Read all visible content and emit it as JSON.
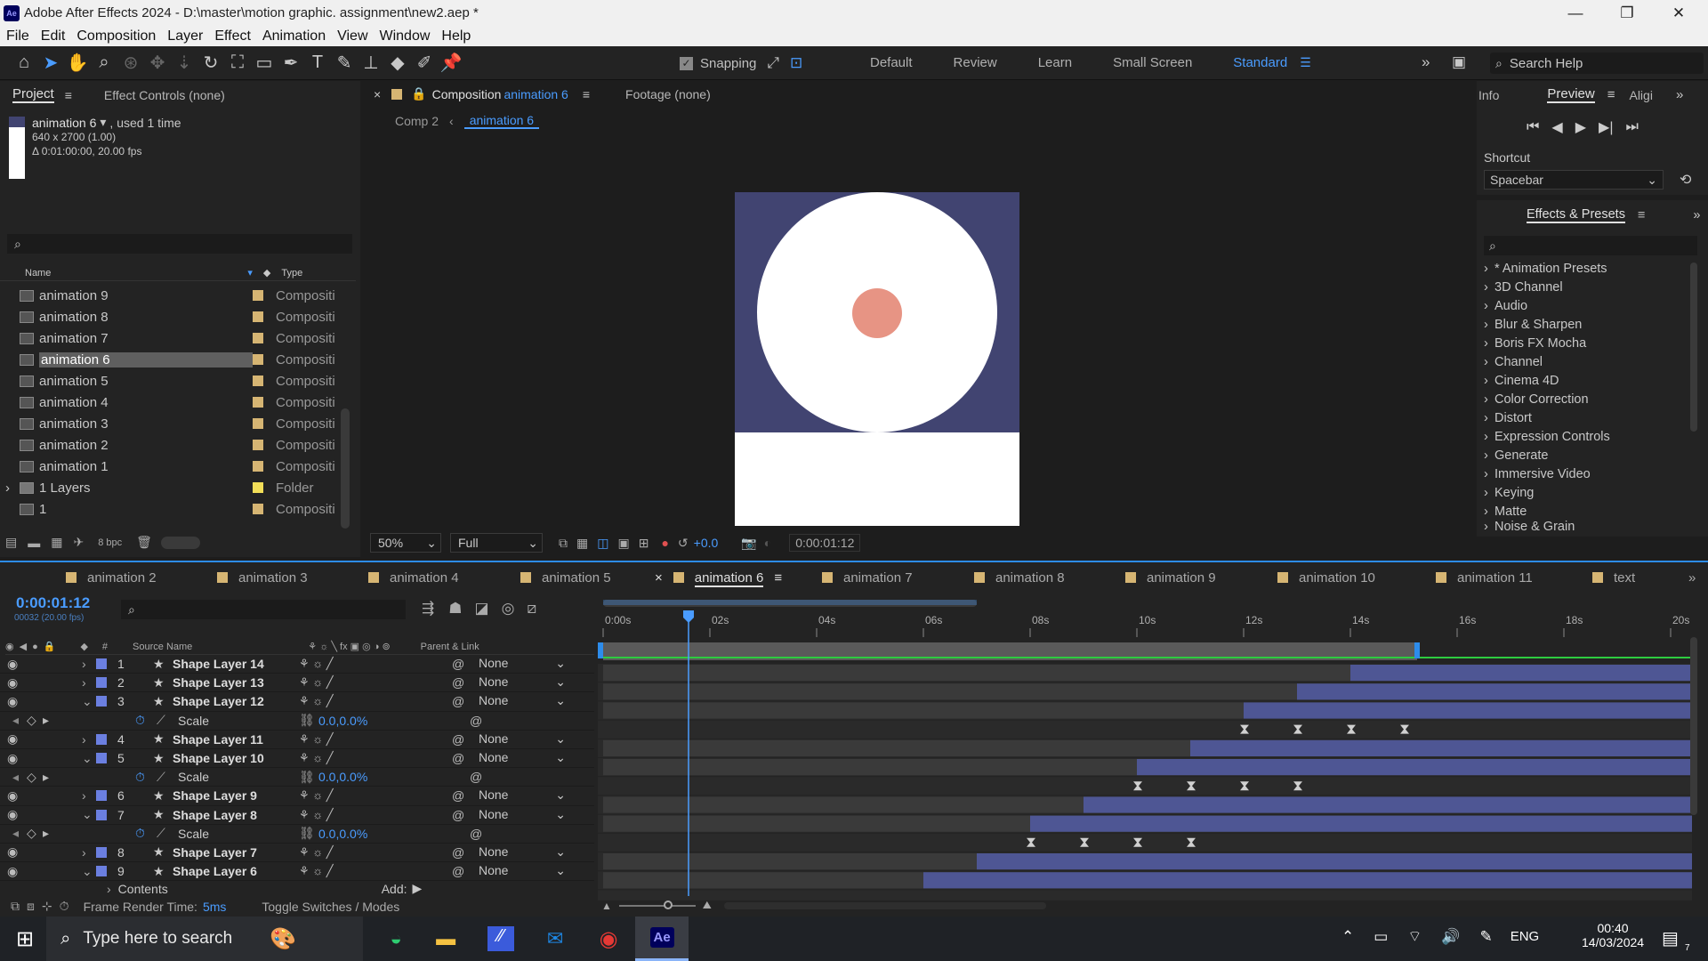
{
  "window": {
    "title": "Adobe After Effects 2024 - D:\\master\\motion graphic. assignment\\new2.aep *",
    "logo": "Ae"
  },
  "menu": [
    "File",
    "Edit",
    "Composition",
    "Layer",
    "Effect",
    "Animation",
    "View",
    "Window",
    "Help"
  ],
  "toolbar": {
    "snapping": "Snapping",
    "workspaces": [
      "Default",
      "Review",
      "Learn",
      "Small Screen",
      "Standard"
    ],
    "search_placeholder": "Search Help"
  },
  "project": {
    "tab": "Project",
    "effect_controls": "Effect Controls (none)",
    "selected_name": "animation 6",
    "used": ", used 1 time",
    "size": "640 x 2700 (1.00)",
    "duration": "Δ 0:01:00:00, 20.00 fps",
    "col_name": "Name",
    "col_type": "Type",
    "bpc": "8 bpc",
    "items": [
      {
        "name": "animation 9",
        "type": "Compositi"
      },
      {
        "name": "animation 8",
        "type": "Compositi"
      },
      {
        "name": "animation 7",
        "type": "Compositi"
      },
      {
        "name": "animation 6",
        "type": "Compositi"
      },
      {
        "name": "animation 5",
        "type": "Compositi"
      },
      {
        "name": "animation 4",
        "type": "Compositi"
      },
      {
        "name": "animation 3",
        "type": "Compositi"
      },
      {
        "name": "animation 2",
        "type": "Compositi"
      },
      {
        "name": "animation 1",
        "type": "Compositi"
      },
      {
        "name": "1 Layers",
        "type": "Folder"
      },
      {
        "name": "1",
        "type": "Compositi"
      }
    ]
  },
  "viewer": {
    "tab_prefix": "Composition",
    "tab_name": "animation 6",
    "footage": "Footage (none)",
    "crumb1": "Comp 2",
    "crumb2": "animation 6",
    "zoom": "50%",
    "resolution": "Full",
    "exposure": "+0.0",
    "timecode": "0:00:01:12",
    "colors": {
      "bg": "#414471",
      "circle": "#ffffff",
      "dot": "#e79484"
    }
  },
  "right": {
    "info": "Info",
    "preview": "Preview",
    "align": "Aligi",
    "shortcut_label": "Shortcut",
    "shortcut_value": "Spacebar",
    "effects_tab": "Effects & Presets",
    "effects": [
      "* Animation Presets",
      "3D Channel",
      "Audio",
      "Blur & Sharpen",
      "Boris FX Mocha",
      "Channel",
      "Cinema 4D",
      "Color Correction",
      "Distort",
      "Expression Controls",
      "Generate",
      "Immersive Video",
      "Keying",
      "Matte",
      "Noise & Grain"
    ]
  },
  "timeline": {
    "tabs": [
      "animation 2",
      "animation 3",
      "animation 4",
      "animation 5",
      "animation 6",
      "animation 7",
      "animation 8",
      "animation 9",
      "animation 10",
      "animation 11",
      "text"
    ],
    "timecode": "0:00:01:12",
    "frames": "00032 (20.00 fps)",
    "col_source": "Source Name",
    "col_parent": "Parent & Link",
    "col_hash": "#",
    "ticks": [
      "0:00s",
      "02s",
      "04s",
      "06s",
      "08s",
      "10s",
      "12s",
      "14s",
      "16s",
      "18s",
      "20s"
    ],
    "layers": [
      {
        "num": "1",
        "name": "Shape Layer 14",
        "parent": "None"
      },
      {
        "num": "2",
        "name": "Shape Layer 13",
        "parent": "None"
      },
      {
        "num": "3",
        "name": "Shape Layer 12",
        "parent": "None"
      },
      {
        "prop": "Scale",
        "value": "0.0,0.0%"
      },
      {
        "num": "4",
        "name": "Shape Layer 11",
        "parent": "None"
      },
      {
        "num": "5",
        "name": "Shape Layer 10",
        "parent": "None"
      },
      {
        "prop": "Scale",
        "value": "0.0,0.0%"
      },
      {
        "num": "6",
        "name": "Shape Layer 9",
        "parent": "None"
      },
      {
        "num": "7",
        "name": "Shape Layer 8",
        "parent": "None"
      },
      {
        "prop": "Scale",
        "value": "0.0,0.0%"
      },
      {
        "num": "8",
        "name": "Shape Layer 7",
        "parent": "None"
      },
      {
        "num": "9",
        "name": "Shape Layer 6",
        "parent": "None"
      }
    ],
    "contents": "Contents",
    "add": "Add:",
    "render_time_label": "Frame Render Time:",
    "render_time": "5ms",
    "toggle": "Toggle Switches / Modes"
  },
  "taskbar": {
    "search": "Type here to search",
    "lang": "ENG",
    "time": "00:40",
    "date": "14/03/2024"
  }
}
